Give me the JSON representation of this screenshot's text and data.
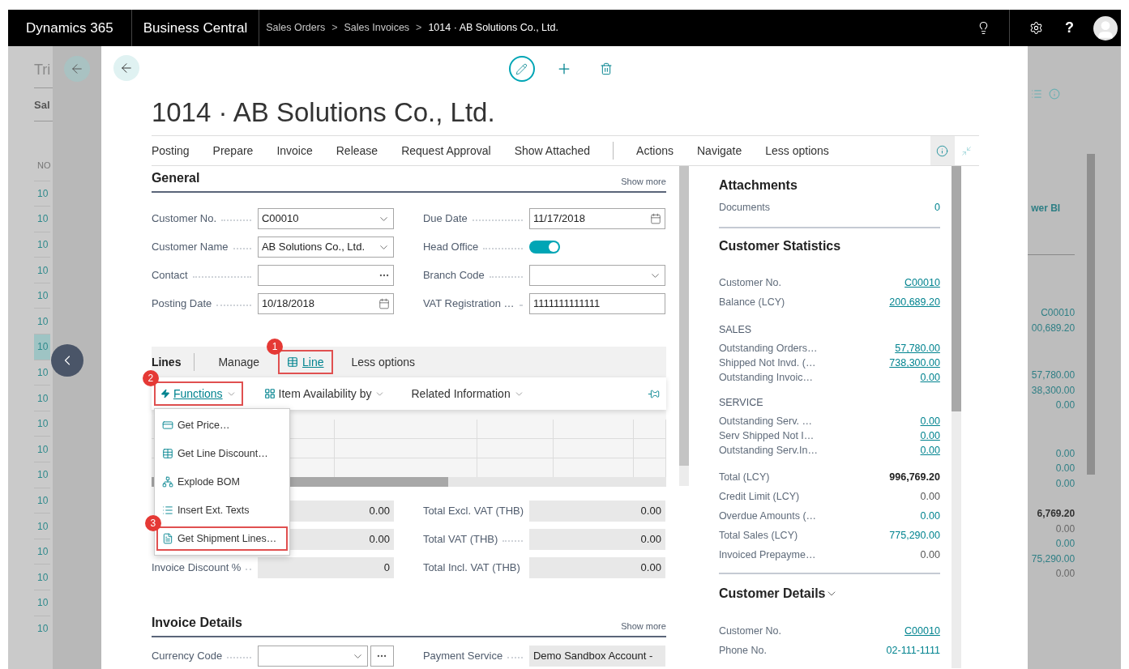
{
  "top_bar": {
    "product": "Dynamics 365",
    "app": "Business Central",
    "breadcrumbs": [
      {
        "label": "Sales Orders",
        "kind": "link"
      },
      {
        "label": ">",
        "kind": "separator"
      },
      {
        "label": "Sales Invoices",
        "kind": "link"
      },
      {
        "label": ">",
        "kind": "separator"
      },
      {
        "label": "1014 · AB Solutions Co., Ltd.",
        "kind": "current"
      }
    ],
    "help": "?"
  },
  "background_list": {
    "title": "Tri",
    "subtitle": "Sal",
    "column": "NO",
    "rows": [
      {
        "no": "10",
        "selected": false
      },
      {
        "no": "10",
        "selected": false
      },
      {
        "no": "10",
        "selected": false
      },
      {
        "no": "10",
        "selected": false
      },
      {
        "no": "10",
        "selected": false
      },
      {
        "no": "10",
        "selected": false
      },
      {
        "no": "10",
        "selected": true
      },
      {
        "no": "10",
        "selected": false
      },
      {
        "no": "10",
        "selected": false
      },
      {
        "no": "10",
        "selected": false
      },
      {
        "no": "10",
        "selected": false
      },
      {
        "no": "10",
        "selected": false
      },
      {
        "no": "10",
        "selected": false
      },
      {
        "no": "10",
        "selected": false
      },
      {
        "no": "10",
        "selected": false
      },
      {
        "no": "10",
        "selected": false
      },
      {
        "no": "10",
        "selected": false
      },
      {
        "no": "10",
        "selected": false
      }
    ]
  },
  "background_factbox": {
    "link": "wer BI",
    "groups": [
      [
        {
          "value": "C00010",
          "kind": "teal"
        },
        {
          "value": "00,689.20",
          "kind": "teal"
        }
      ],
      [
        {
          "value": "57,780.00",
          "kind": "teal"
        },
        {
          "value": "38,300.00",
          "kind": "teal"
        },
        {
          "value": "0.00",
          "kind": "teal"
        }
      ],
      [
        {
          "value": "0.00",
          "kind": "teal"
        },
        {
          "value": "0.00",
          "kind": "teal"
        },
        {
          "value": "0.00",
          "kind": "teal"
        }
      ],
      [
        {
          "value": "6,769.20",
          "kind": "bold"
        },
        {
          "value": "0.00",
          "kind": "plain"
        },
        {
          "value": "0.00",
          "kind": "teal"
        },
        {
          "value": "75,290.00",
          "kind": "teal"
        },
        {
          "value": "0.00",
          "kind": "plain"
        }
      ]
    ]
  },
  "page": {
    "title": "1014 · AB Solutions Co., Ltd.",
    "actions": [
      "Posting",
      "Prepare",
      "Invoice",
      "Release",
      "Request Approval",
      "Show Attached"
    ],
    "more_actions": [
      "Actions",
      "Navigate",
      "Less options"
    ]
  },
  "general": {
    "title": "General",
    "show_more": "Show more",
    "left_fields": [
      {
        "label": "Customer No.",
        "value": "C00010",
        "kind": "dropdown"
      },
      {
        "label": "Customer Name",
        "value": "AB Solutions Co., Ltd.",
        "kind": "dropdown"
      },
      {
        "label": "Contact",
        "kind": "lookup"
      },
      {
        "label": "Posting Date",
        "value": "10/18/2018",
        "kind": "date"
      }
    ],
    "right_fields": [
      {
        "label": "Due Date",
        "value": "11/17/2018",
        "kind": "date"
      },
      {
        "label": "Head Office",
        "kind": "toggle",
        "on": true
      },
      {
        "label": "Branch Code",
        "kind": "dropdown"
      },
      {
        "label": "VAT Registration …",
        "value": "1111111111111",
        "kind": "text"
      }
    ]
  },
  "lines": {
    "title": "Lines",
    "tabs": [
      {
        "label": "Manage",
        "selected": false
      },
      {
        "label": "Line",
        "selected": true,
        "callout": "1"
      },
      {
        "label": "Less options",
        "selected": false
      }
    ],
    "toolbar": [
      {
        "label": "Functions",
        "expanded": true,
        "callout": "2"
      },
      {
        "label": "Item Availability by",
        "expanded": false
      },
      {
        "label": "Related Information",
        "expanded": false
      }
    ],
    "menu": [
      {
        "label": "Get Price…",
        "selected": false
      },
      {
        "label": "Get Line Discount…",
        "selected": false
      },
      {
        "label": "Explode BOM",
        "selected": false
      },
      {
        "label": "Insert Ext. Texts",
        "selected": false
      },
      {
        "label": "Get Shipment Lines…",
        "selected": true,
        "callout": "3"
      }
    ]
  },
  "totals": {
    "left": [
      {
        "value": "0.00"
      },
      {
        "value": "0.00"
      },
      {
        "label": "Invoice Discount %",
        "value": "0"
      }
    ],
    "right": [
      {
        "label": "Total Excl. VAT (THB)",
        "value": "0.00"
      },
      {
        "label": "Total VAT (THB)",
        "value": "0.00"
      },
      {
        "label": "Total Incl. VAT (THB)",
        "value": "0.00"
      }
    ]
  },
  "invoice_details": {
    "title": "Invoice Details",
    "show_more": "Show more",
    "fields": [
      {
        "label": "Currency Code",
        "kind": "dropdown_lookup"
      },
      {
        "label": "Payment Service",
        "value": "Demo Sandbox Account -",
        "kind": "readonly"
      }
    ]
  },
  "factbox": {
    "attachments": {
      "title": "Attachments",
      "rows": [
        {
          "label": "Documents",
          "value": "0",
          "kind": "teal"
        }
      ]
    },
    "statistics": {
      "title": "Customer Statistics",
      "groups": [
        {
          "rows": [
            {
              "label": "Customer No.",
              "value": "C00010",
              "kind": "link"
            },
            {
              "label": "Balance (LCY)",
              "value": "200,689.20",
              "kind": "link"
            }
          ]
        },
        {
          "heading": "SALES",
          "rows": [
            {
              "label": "Outstanding Orders…",
              "value": "57,780.00",
              "kind": "link"
            },
            {
              "label": "Shipped Not Invd. (…",
              "value": "738,300.00",
              "kind": "link"
            },
            {
              "label": "Outstanding Invoic…",
              "value": "0.00",
              "kind": "link"
            }
          ]
        },
        {
          "heading": "SERVICE",
          "rows": [
            {
              "label": "Outstanding Serv. …",
              "value": "0.00",
              "kind": "link"
            },
            {
              "label": "Serv Shipped Not I…",
              "value": "0.00",
              "kind": "link"
            },
            {
              "label": "Outstanding Serv.In…",
              "value": "0.00",
              "kind": "link"
            }
          ]
        },
        {
          "rows": [
            {
              "label": "Total (LCY)",
              "value": "996,769.20",
              "kind": "bold"
            },
            {
              "label": "Credit Limit (LCY)",
              "value": "0.00",
              "kind": "plain"
            },
            {
              "label": "Overdue Amounts (…",
              "value": "0.00",
              "kind": "teal"
            },
            {
              "label": "Total Sales (LCY)",
              "value": "775,290.00",
              "kind": "teal"
            },
            {
              "label": "Invoiced Prepayme…",
              "value": "0.00",
              "kind": "plain"
            }
          ]
        }
      ]
    },
    "details": {
      "title": "Customer Details",
      "rows": [
        {
          "label": "Customer No.",
          "value": "C00010",
          "kind": "link"
        },
        {
          "label": "Phone No.",
          "value": "02-111-1111",
          "kind": "teal"
        }
      ]
    }
  }
}
